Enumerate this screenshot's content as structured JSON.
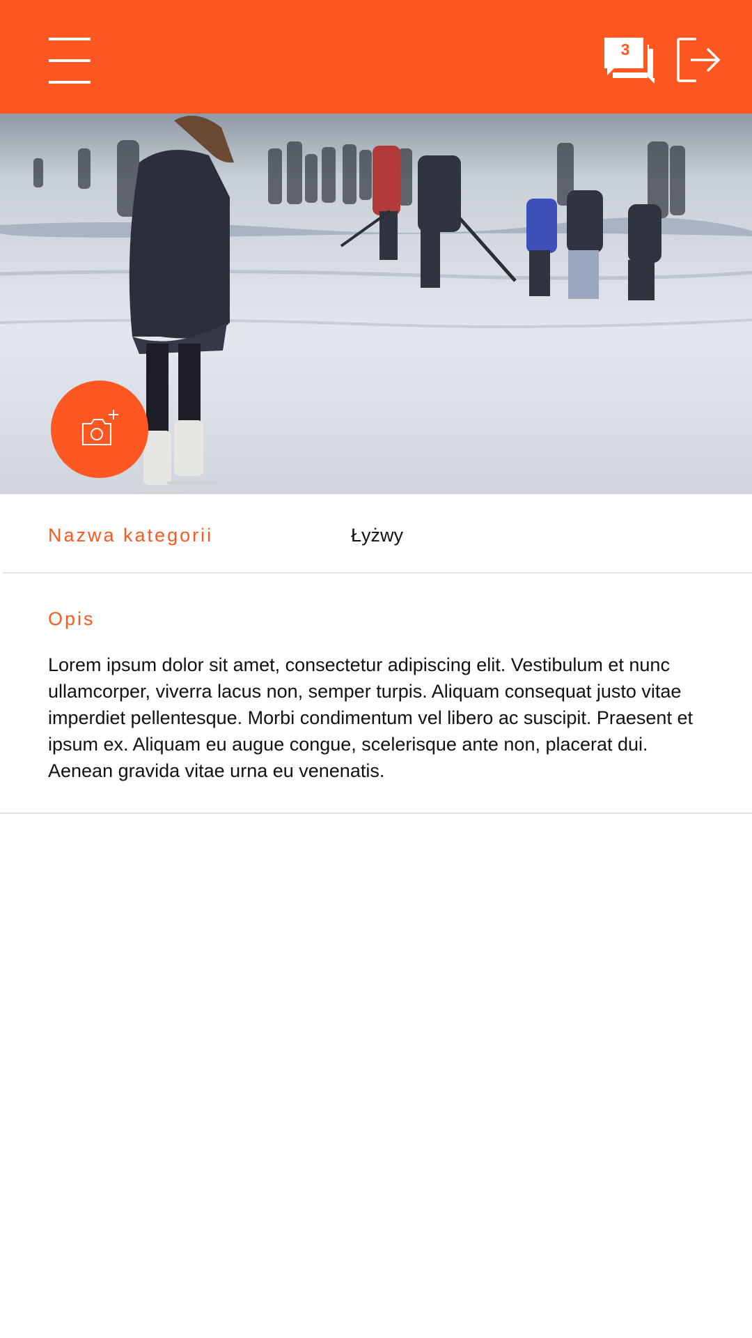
{
  "colors": {
    "accent": "#ff5722",
    "text": "#111111",
    "divider": "#e4e4e4"
  },
  "header": {
    "menu_icon": "hamburger-menu-icon",
    "chat_icon": "chat-bubbles-icon",
    "chat_count": "3",
    "logout_icon": "logout-icon"
  },
  "hero": {
    "image_subject": "people ice skating on a frozen lake",
    "add_photo_icon": "camera-plus-icon"
  },
  "category": {
    "label": "Nazwa kategorii",
    "value": "Łyżwy"
  },
  "description": {
    "label": "Opis",
    "text": "Lorem ipsum dolor sit amet, consectetur adipiscing elit. Vestibulum et nunc ullamcorper, viverra lacus non, semper turpis. Aliquam consequat justo vitae imperdiet pellentesque. Morbi condimentum vel libero ac suscipit. Praesent et ipsum ex. Aliquam eu augue congue, scelerisque ante non, placerat dui. Aenean gravida vitae urna eu venenatis."
  }
}
